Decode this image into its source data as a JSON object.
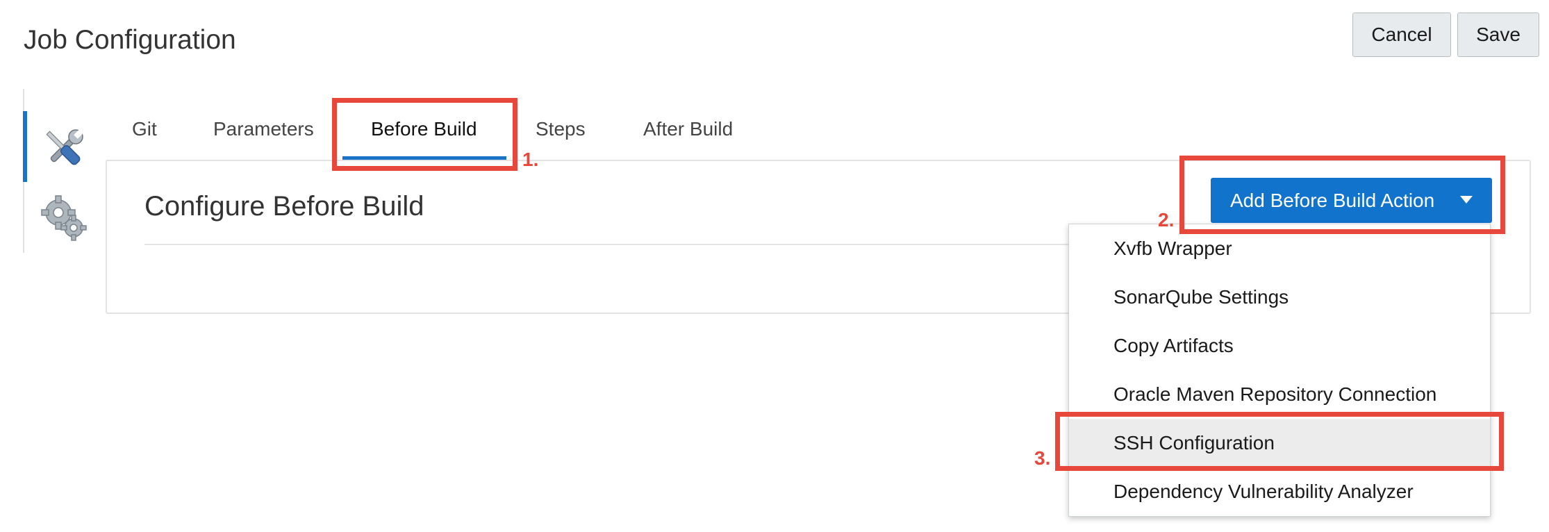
{
  "header": {
    "title": "Job Configuration",
    "cancel_label": "Cancel",
    "save_label": "Save"
  },
  "side_nav": {
    "items": [
      {
        "icon": "tools-icon",
        "active": true
      },
      {
        "icon": "gears-icon",
        "active": false
      }
    ]
  },
  "tabs": [
    {
      "label": "Git"
    },
    {
      "label": "Parameters"
    },
    {
      "label": "Before Build",
      "active": true
    },
    {
      "label": "Steps"
    },
    {
      "label": "After Build"
    }
  ],
  "panel": {
    "title": "Configure Before Build",
    "add_action_label": "Add Before Build Action"
  },
  "menu": {
    "items": [
      {
        "label": "Xvfb Wrapper"
      },
      {
        "label": "SonarQube Settings"
      },
      {
        "label": "Copy Artifacts"
      },
      {
        "label": "Oracle Maven Repository Connection"
      },
      {
        "label": "SSH Configuration",
        "highlighted": true
      },
      {
        "label": "Dependency Vulnerability Analyzer"
      }
    ]
  },
  "annotations": {
    "step1": "1.",
    "step2": "2.",
    "step3": "3."
  },
  "colors": {
    "accent": "#1173cc",
    "annotation": "#e8473b"
  }
}
